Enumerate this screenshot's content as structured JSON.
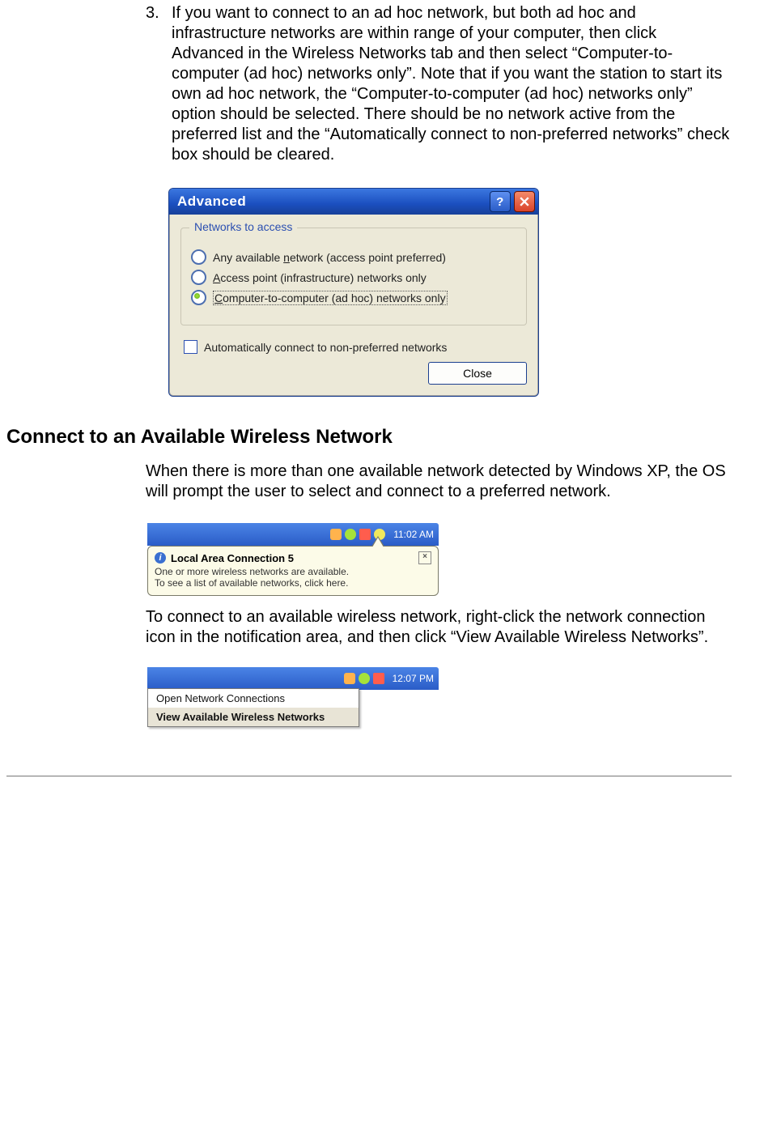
{
  "step3": {
    "number": "3.",
    "text": "If you want to connect to an ad hoc network, but both ad hoc and infrastructure networks are within range of your computer, then click Advanced in the Wireless Networks tab and then select “Computer-to-computer (ad hoc) networks only”. Note that if you want the station to start its own ad hoc network, the “Computer-to-computer (ad hoc) networks only” option should be selected. There should be no network active from the preferred list and the “Automatically connect to non-preferred networks” check box should be cleared."
  },
  "advanced_dialog": {
    "title": "Advanced",
    "group_legend": "Networks to access",
    "options": [
      "Any available network (access point preferred)",
      "Access point (infrastructure) networks only",
      "Computer-to-computer (ad hoc) networks only"
    ],
    "selected_index": 2,
    "auto_checkbox_label": "Automatically connect to non-preferred networks",
    "auto_checkbox_checked": false,
    "close_button": "Close"
  },
  "section2": {
    "heading": "Connect to an Available Wireless Network",
    "para1": "When there is more than one available network detected by Windows XP, the OS will prompt the user to select and connect to a preferred network.",
    "para2": "To connect to an available wireless network, right-click the network connection icon in the notification area, and then click “View Available Wireless Networks”."
  },
  "balloon": {
    "clock": "11:02 AM",
    "title": "Local Area Connection 5",
    "line1": "One or more wireless networks are available.",
    "line2": "To see a list of available networks, click here."
  },
  "context_menu": {
    "clock": "12:07 PM",
    "items": [
      "Open Network Connections",
      "View Available Wireless Networks"
    ],
    "selected_index": 1
  }
}
